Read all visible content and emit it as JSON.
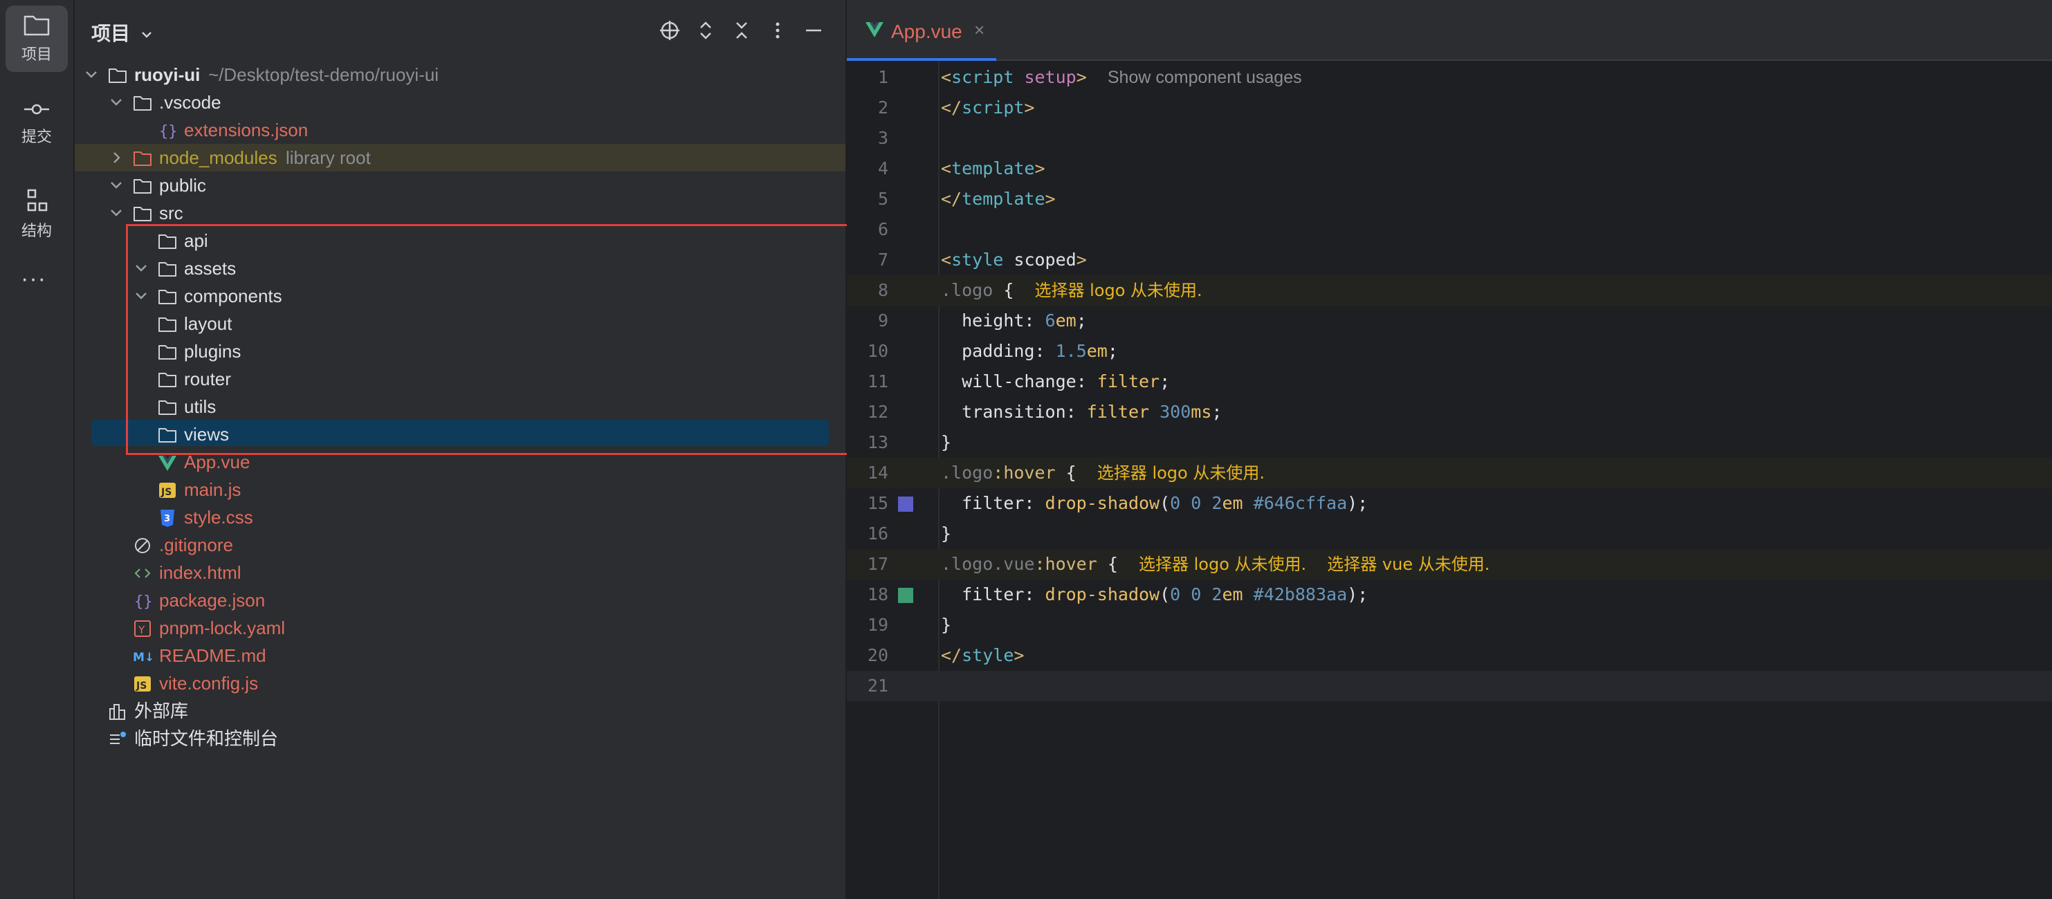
{
  "activity": {
    "items": [
      {
        "label": "项目",
        "icon": "folder-icon"
      },
      {
        "label": "提交",
        "icon": "commit-icon"
      },
      {
        "label": "结构",
        "icon": "structure-icon"
      }
    ],
    "more": "···"
  },
  "project": {
    "title": "项目",
    "tree": [
      {
        "label": "ruoyi-ui",
        "hint": "~/Desktop/test-demo/ruoyi-ui",
        "icon": "folder-icon"
      },
      {
        "label": ".vscode",
        "icon": "folder-icon"
      },
      {
        "label": "extensions.json",
        "icon": "json-file-icon"
      },
      {
        "label": "node_modules",
        "hint": "library root",
        "icon": "folder-icon"
      },
      {
        "label": "public",
        "icon": "folder-icon"
      },
      {
        "label": "src",
        "icon": "folder-icon"
      },
      {
        "label": "api",
        "icon": "folder-icon"
      },
      {
        "label": "assets",
        "icon": "folder-icon"
      },
      {
        "label": "components",
        "icon": "folder-icon"
      },
      {
        "label": "layout",
        "icon": "folder-icon"
      },
      {
        "label": "plugins",
        "icon": "folder-icon"
      },
      {
        "label": "router",
        "icon": "folder-icon"
      },
      {
        "label": "utils",
        "icon": "folder-icon"
      },
      {
        "label": "views",
        "icon": "folder-icon"
      },
      {
        "label": "App.vue",
        "icon": "vue-file-icon"
      },
      {
        "label": "main.js",
        "icon": "js-file-icon"
      },
      {
        "label": "style.css",
        "icon": "css-file-icon"
      },
      {
        "label": ".gitignore",
        "icon": "ignore-file-icon"
      },
      {
        "label": "index.html",
        "icon": "html-file-icon"
      },
      {
        "label": "package.json",
        "icon": "json-file-icon"
      },
      {
        "label": "pnpm-lock.yaml",
        "icon": "yaml-file-icon"
      },
      {
        "label": "README.md",
        "icon": "markdown-file-icon"
      },
      {
        "label": "vite.config.js",
        "icon": "js-file-icon"
      },
      {
        "label": "外部库",
        "icon": "library-icon"
      },
      {
        "label": "临时文件和控制台",
        "icon": "scratches-icon"
      }
    ]
  },
  "editor": {
    "tab": {
      "label": "App.vue",
      "close": "×"
    },
    "line_numbers": [
      "1",
      "2",
      "3",
      "4",
      "5",
      "6",
      "7",
      "8",
      "9",
      "10",
      "11",
      "12",
      "13",
      "14",
      "15",
      "16",
      "17",
      "18",
      "19",
      "20",
      "21"
    ],
    "code": {
      "l1_inlay": "Show component usages",
      "l8_warn": "选择器 logo 从未使用.",
      "l14_warn": "选择器 logo 从未使用.",
      "l17_warn1": "选择器 logo 从未使用.",
      "l17_warn2": "选择器 vue 从未使用."
    },
    "swatch_colors": {
      "line15": "#646cffaa",
      "line18": "#42b883aa"
    }
  },
  "colors": {
    "accent": "#3574f0",
    "highlight_frame": "#e0403a",
    "selection": "#0f3b5a"
  }
}
